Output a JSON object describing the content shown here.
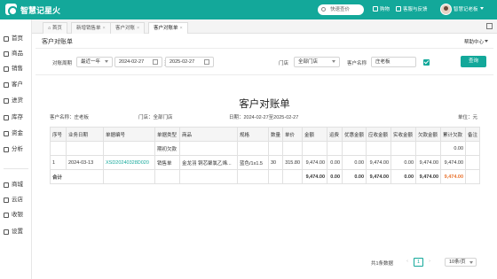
{
  "app": {
    "name": "智慧记星火",
    "search_label": "快速查价",
    "purchase_label": "购物",
    "service_label": "客服与反馈",
    "user_name": "智慧记老板",
    "brand_color": "#13a89a"
  },
  "sidebar": {
    "items": [
      {
        "label": "首页",
        "icon": "home-icon"
      },
      {
        "label": "商品",
        "icon": "goods-icon"
      },
      {
        "label": "销售",
        "icon": "sales-icon"
      },
      {
        "label": "客户",
        "icon": "customer-icon"
      },
      {
        "label": "进货",
        "icon": "purchase-icon"
      },
      {
        "label": "库存",
        "icon": "inventory-icon"
      },
      {
        "label": "资金",
        "icon": "funds-icon"
      },
      {
        "label": "分析",
        "icon": "analysis-icon"
      },
      {
        "label": "商城",
        "icon": "mall-icon"
      },
      {
        "label": "云店",
        "icon": "cloud-store-icon"
      },
      {
        "label": "收银",
        "icon": "cashier-icon"
      },
      {
        "label": "设置",
        "icon": "settings-icon"
      }
    ]
  },
  "tabs": [
    {
      "label": "首页"
    },
    {
      "label": "新增销售单"
    },
    {
      "label": "客户对账"
    },
    {
      "label": "客户对账单"
    }
  ],
  "page": {
    "title": "客户对账单",
    "help_label": "帮助中心"
  },
  "filters": {
    "period_label": "对账周期",
    "period_value": "最近一年",
    "date_start": "2024-02-27",
    "date_sep": "至",
    "date_end": "2025-02-27",
    "store_label": "门店",
    "store_value": "全部门店",
    "customer_label": "客户名称",
    "customer_value": "庄老板",
    "query_label": "查询"
  },
  "report": {
    "title": "客户对账单",
    "customer_meta": "客户名称：庄老板",
    "store_meta": "门店：全部门店",
    "date_meta": "日期：2024-02-27至2025-02-27",
    "unit_meta": "单位：元",
    "columns": [
      "序号",
      "业务日期",
      "单据编号",
      "单据类型",
      "商品",
      "规格",
      "数量",
      "单价",
      "金额",
      "运费",
      "优惠金额",
      "应收金额",
      "实收金额",
      "欠款金额",
      "累计欠款",
      "备注"
    ],
    "opening_row": {
      "type": "期初欠款",
      "cumulative": "0.00"
    },
    "rows": [
      {
        "index": "1",
        "date": "2024-03-13",
        "doc_no": "XSD20240328D020",
        "type": "销售单",
        "product": "金龙羽 铜芯聚氯乙烯...",
        "spec": "蓝色/1x1.5",
        "qty": "30",
        "price": "315.80",
        "amount": "9,474.00",
        "freight": "0.00",
        "discount": "0.00",
        "receivable": "9,474.00",
        "received": "0.00",
        "debt": "9,474.00",
        "cumulative": "9,474.00",
        "remark": ""
      }
    ],
    "total": {
      "label": "合计",
      "amount": "9,474.00",
      "freight": "0.00",
      "discount": "0.00",
      "receivable": "9,474.00",
      "received": "0.00",
      "debt": "9,474.00",
      "cumulative": "9,474.00"
    }
  },
  "pager": {
    "total_text": "共1条数据",
    "current_page": "1",
    "page_size": "10条/页"
  }
}
